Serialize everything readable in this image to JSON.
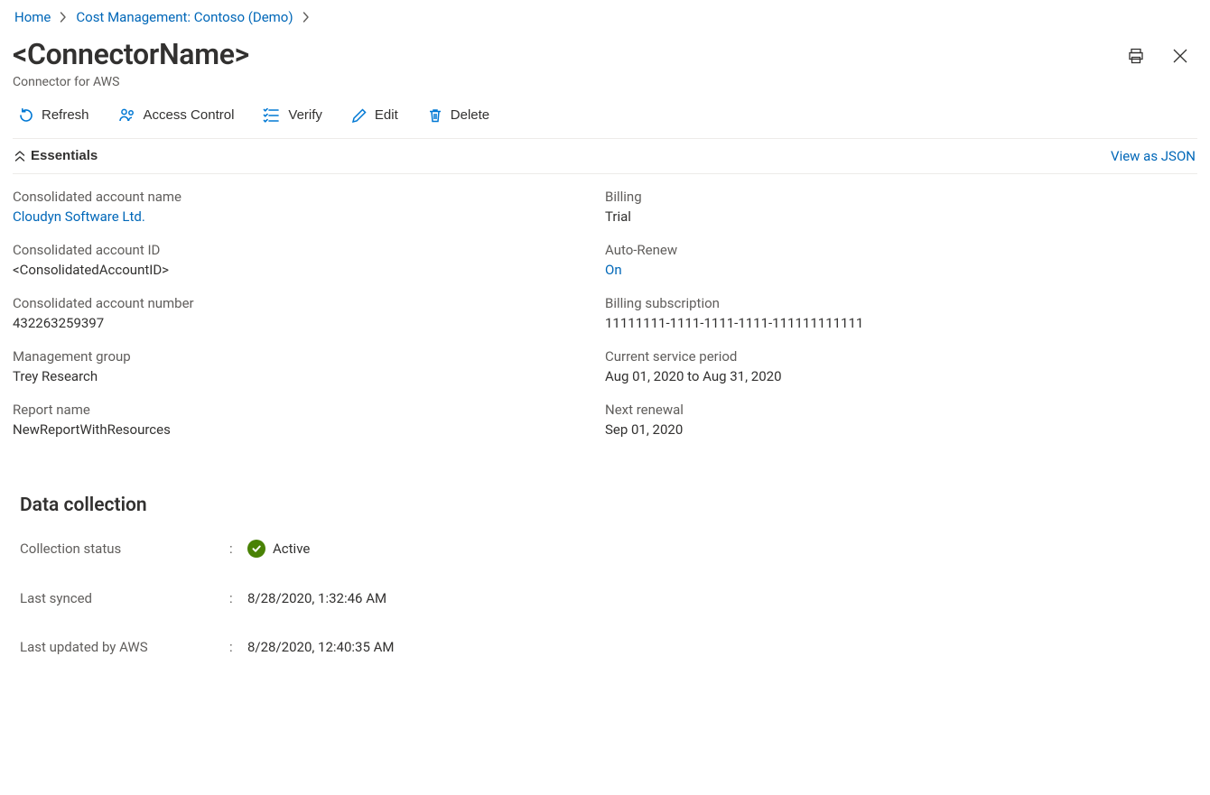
{
  "breadcrumb": {
    "home": "Home",
    "cost_mgmt": "Cost Management: Contoso (Demo)"
  },
  "header": {
    "title": "<ConnectorName>",
    "subtitle": "Connector for AWS"
  },
  "toolbar": {
    "refresh": "Refresh",
    "access_control": "Access Control",
    "verify": "Verify",
    "edit": "Edit",
    "delete": "Delete"
  },
  "essentials_header": {
    "label": "Essentials",
    "view_json": "View as JSON"
  },
  "essentials": {
    "left": [
      {
        "label": "Consolidated account name",
        "value": "Cloudyn Software Ltd.",
        "link": true
      },
      {
        "label": "Consolidated account ID",
        "value": "<ConsolidatedAccountID>"
      },
      {
        "label": "Consolidated account number",
        "value": "432263259397"
      },
      {
        "label": "Management group",
        "value": "Trey Research"
      },
      {
        "label": "Report name",
        "value": "NewReportWithResources"
      }
    ],
    "right": [
      {
        "label": "Billing",
        "value": "Trial"
      },
      {
        "label": "Auto-Renew",
        "value": "On",
        "link": true
      },
      {
        "label": "Billing subscription",
        "value": "11111111-1111-1111-1111-111111111111"
      },
      {
        "label": "Current service period",
        "value": "Aug 01, 2020 to Aug 31, 2020"
      },
      {
        "label": "Next renewal",
        "value": "Sep 01, 2020"
      }
    ]
  },
  "data_collection": {
    "title": "Data collection",
    "rows": {
      "collection_status": {
        "label": "Collection status",
        "value": "Active",
        "status": "active"
      },
      "last_synced": {
        "label": "Last synced",
        "value": "8/28/2020, 1:32:46 AM"
      },
      "last_updated": {
        "label": "Last updated by AWS",
        "value": "8/28/2020, 12:40:35 AM"
      }
    }
  }
}
